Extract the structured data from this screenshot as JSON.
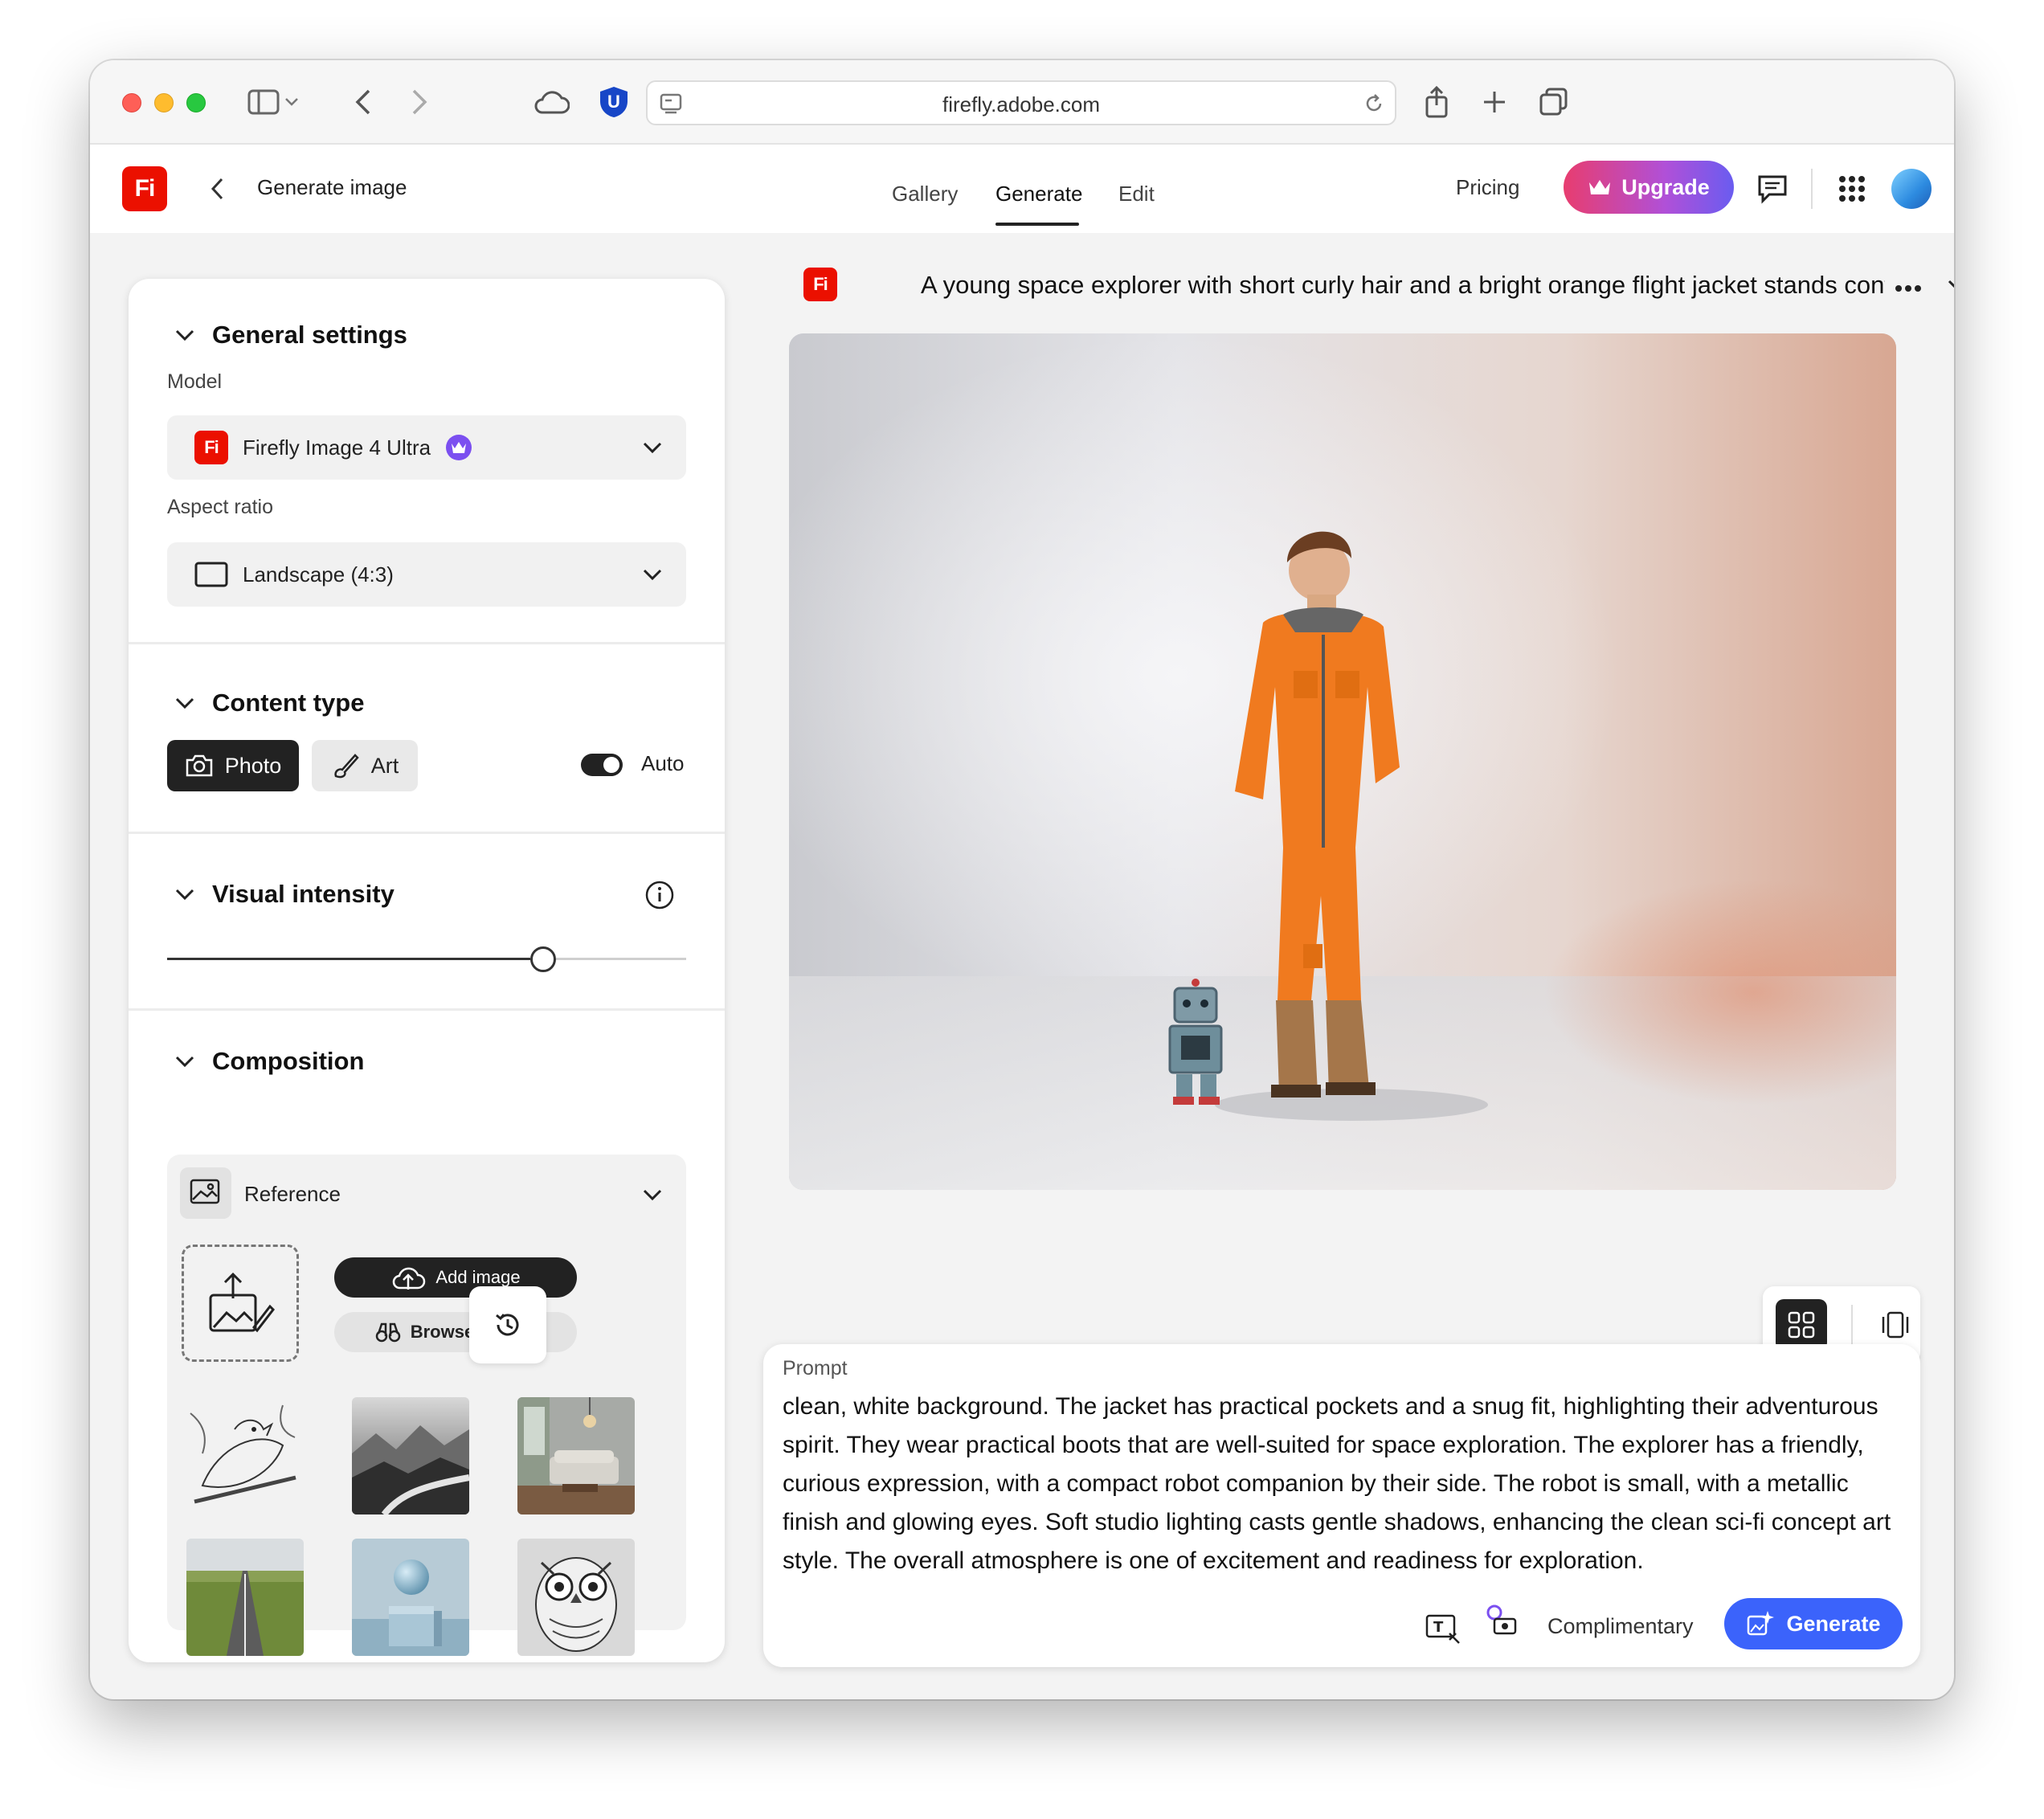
{
  "browser": {
    "url": "firefly.adobe.com",
    "extension_badge": "U"
  },
  "header": {
    "logo": "Fi",
    "title": "Generate image",
    "tabs": [
      {
        "label": "Gallery",
        "active": false
      },
      {
        "label": "Generate",
        "active": true
      },
      {
        "label": "Edit",
        "active": false
      }
    ],
    "pricing": "Pricing",
    "upgrade": "Upgrade"
  },
  "settings": {
    "general": {
      "title": "General settings",
      "model_label": "Model",
      "model_value": "Firefly Image 4 Ultra",
      "aspect_label": "Aspect ratio",
      "aspect_value": "Landscape (4:3)"
    },
    "content_type": {
      "title": "Content type",
      "photo": "Photo",
      "art": "Art",
      "selected": "Photo",
      "auto_label": "Auto",
      "auto_on": true
    },
    "visual_intensity": {
      "title": "Visual intensity",
      "value_fraction": 0.74
    },
    "composition": {
      "title": "Composition",
      "reference_label": "Reference",
      "add_image": "Add image",
      "browse_gallery": "Browse gallery"
    }
  },
  "main": {
    "prompt_title": "A young space explorer with short curly hair and a bright orange flight jacket stands confident",
    "prompt_label": "Prompt",
    "prompt_text": "clean, white background. The jacket has practical pockets and a snug fit, highlighting their adventurous spirit. They wear practical boots that are well-suited for space exploration. The explorer has a friendly, curious expression, with a compact robot companion by their side. The robot is small, with a metallic finish and glowing eyes. Soft studio lighting casts gentle shadows, enhancing the clean sci-fi concept art style. The overall atmosphere is one of excitement and readiness for exploration.",
    "complimentary": "Complimentary",
    "generate": "Generate"
  },
  "colors": {
    "brand_red": "#eb1000",
    "generate_blue": "#3b63fb",
    "upgrade_pink": "#e83d6f",
    "upgrade_purple": "#6a5cf0"
  }
}
